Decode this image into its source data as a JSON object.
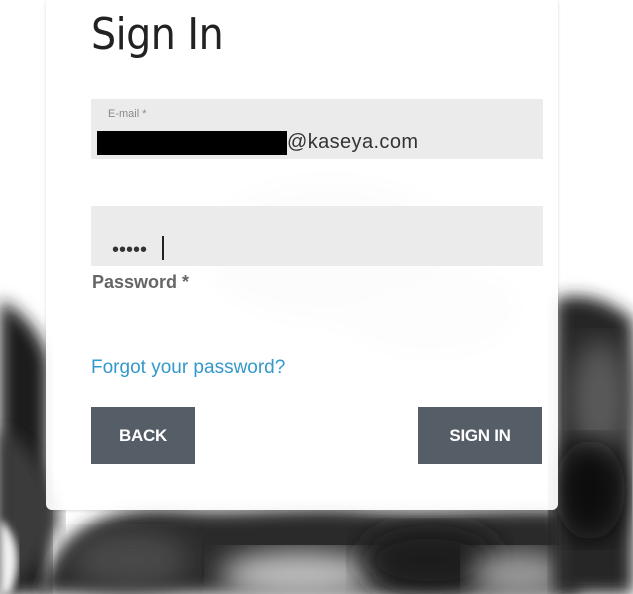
{
  "page": {
    "title": "Sign In"
  },
  "email": {
    "label": "E-mail *",
    "value_visible": "@kaseya.com"
  },
  "password": {
    "masked_value": "•••••",
    "label": "Password *"
  },
  "links": {
    "forgot": "Forgot your password?"
  },
  "buttons": {
    "back": "BACK",
    "sign_in": "SIGN IN"
  },
  "colors": {
    "link": "#3399cc",
    "button_bg": "#555d66",
    "field_bg": "#ebebeb"
  }
}
